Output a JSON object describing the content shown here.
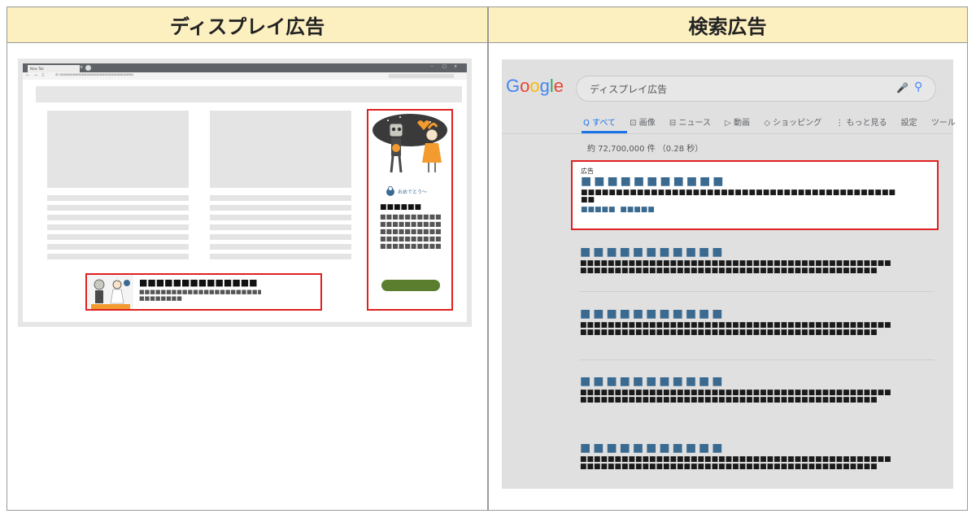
{
  "headers": {
    "display": "ディスプレイ広告",
    "search": "検索広告"
  },
  "browser": {
    "tab_title": "New Tab",
    "tab_close": "×",
    "win_min": "–",
    "win_max": "□",
    "win_close": "×",
    "nav": "← → C",
    "url": "⊘ ooooooooooooooooooooooooooooooooo"
  },
  "display_ad": {
    "sidebar_caption": "おめでとう〜",
    "sidebar_title": "■■■■■■",
    "sidebar_body": "■■■■■■■■■■■■■■■■■■■■■■■■■■■■■■■■■■■■■■■■■■■■■■■■■■■■■",
    "banner_title": "■■■■■■■■■■■■■■",
    "banner_body_1": "■■■■■■■■■■■■■■■■■■■■■■■■■",
    "banner_body_2": "■■■■■■■■"
  },
  "search": {
    "logo": [
      "G",
      "o",
      "o",
      "g",
      "l",
      "e"
    ],
    "logo_colors": [
      "#4285f4",
      "#ea4335",
      "#fbbc05",
      "#4285f4",
      "#34a853",
      "#ea4335"
    ],
    "query": "ディスプレイ広告",
    "tabs": [
      "Q すべて",
      "⊡ 画像",
      "⊟ ニュース",
      "▷ 動画",
      "◇ ショッピング",
      "⋮ もっと見る",
      "設定",
      "ツール"
    ],
    "stats": "約 72,700,000 件 （0.28 秒）",
    "ad_label": "広告",
    "ad_title": "■■■■■■■■■■■",
    "ad_desc_1": "■■■■■■■■■■■■■■■■■■■■■■■■■■■■■■■■■■■■■■■■■■■■■",
    "ad_desc_2": "■■",
    "ad_links": "■■■■■  ■■■■■",
    "result_title": "■■■■■■■■■■■",
    "result_desc_1": "■■■■■■■■■■■■■■■■■■■■■■■■■■■■■■■■■■■■■■■■■■■■■",
    "result_desc_2": "■■■■■■■■■■■■■■■■■■■■■■■■■■■■■■■■■■■■■■■■■■■■"
  }
}
